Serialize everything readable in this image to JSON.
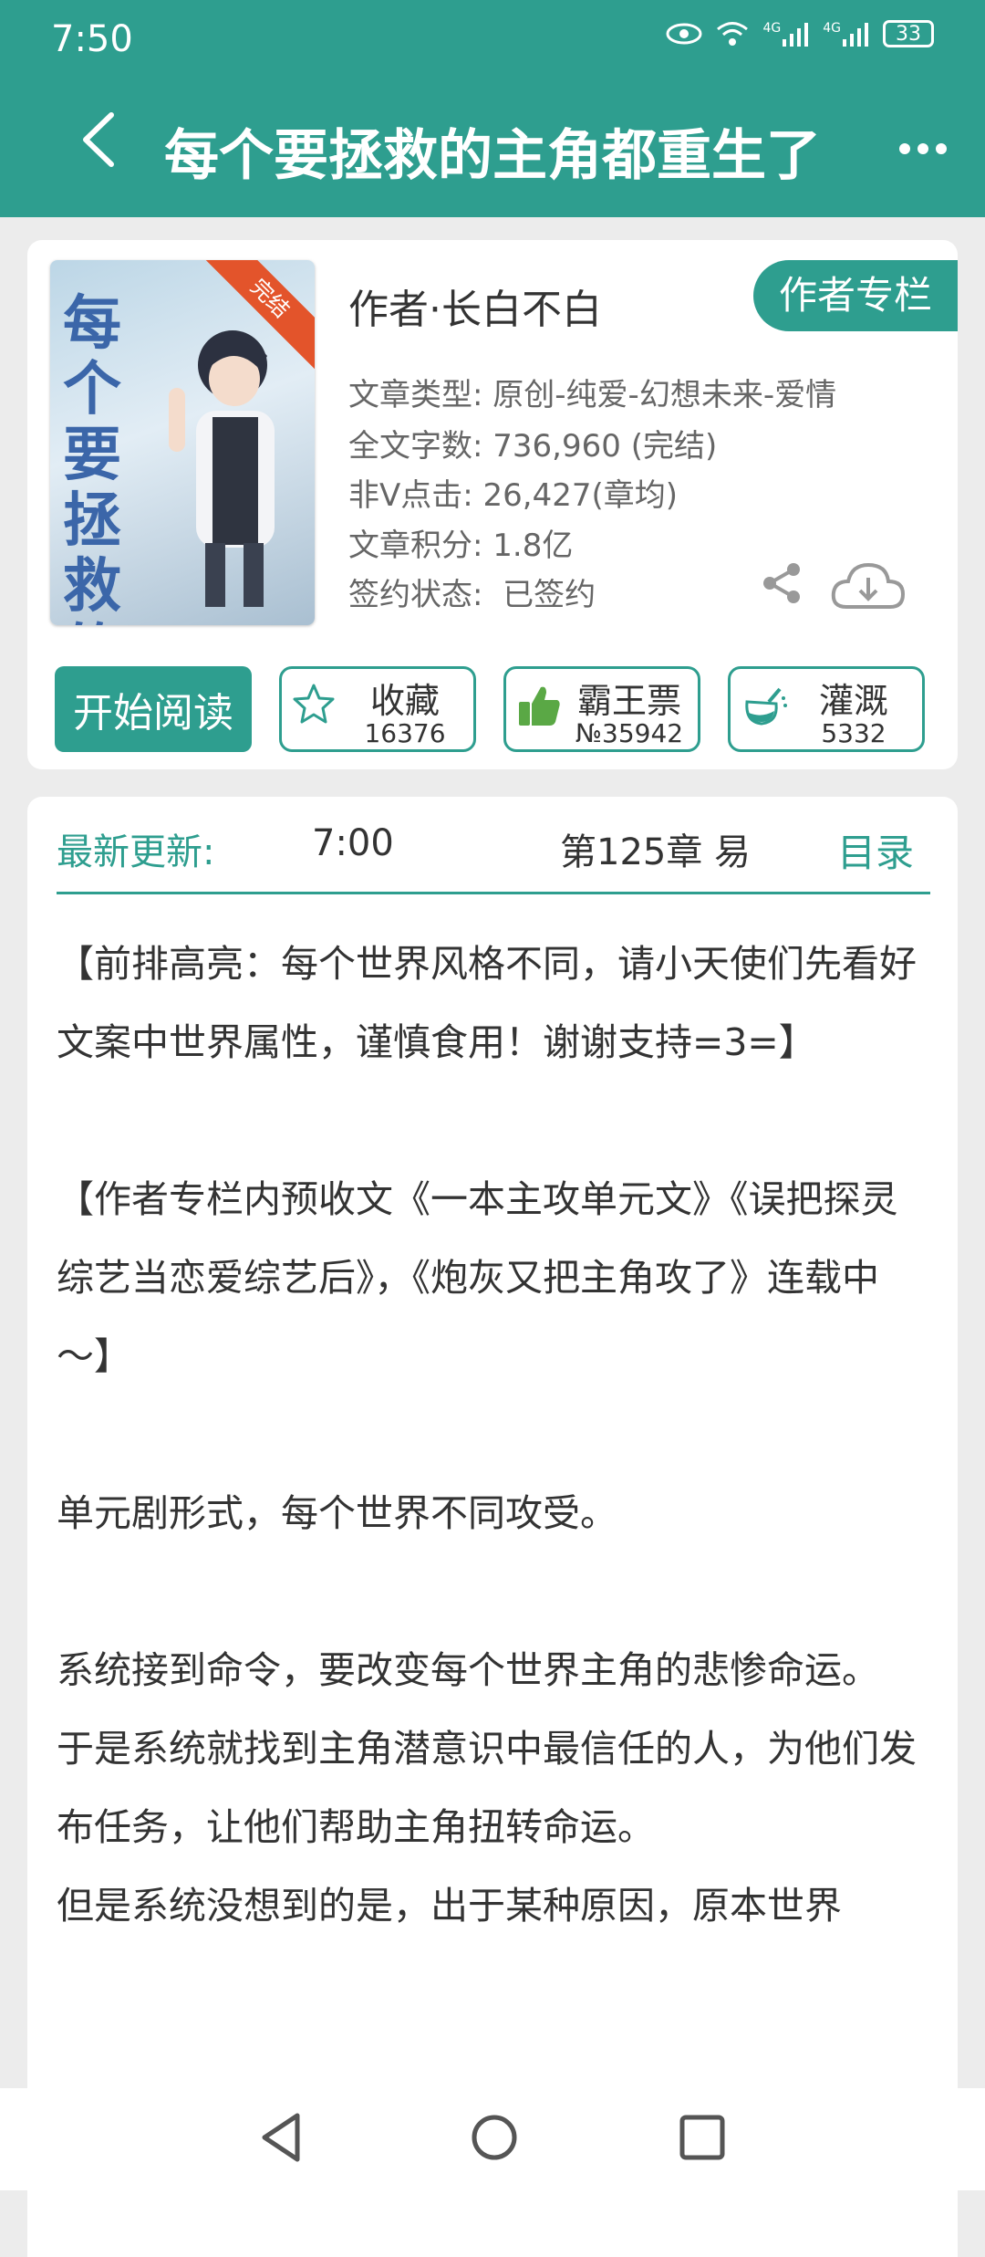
{
  "status_bar": {
    "time": "7:50",
    "network1": "4G",
    "network2": "4G",
    "battery": "33"
  },
  "header": {
    "title": "每个要拯救的主角都重生了",
    "back_icon": "chevron-left-icon",
    "more_icon": "more-horizontal-icon"
  },
  "book": {
    "cover_ribbon": "完结",
    "cover_title": "每个要 拯救的主角 都重生了",
    "author": "作者·长白不白",
    "author_column_button": "作者专栏",
    "meta": [
      {
        "label": "文章类型:",
        "value": "原创-纯爱-幻想未来-爱情"
      },
      {
        "label": "全文字数:",
        "value": "736,960 (完结)"
      },
      {
        "label": "非Ⅴ点击:",
        "value": "26,427(章均)"
      },
      {
        "label": "文章积分:",
        "value": "1.8亿"
      },
      {
        "label": "签约状态:",
        "value": "已签约"
      }
    ]
  },
  "actions": {
    "start_reading": "开始阅读",
    "favorite": {
      "label": "收藏",
      "count": "16376"
    },
    "tickets": {
      "label": "霸王票",
      "count": "№35942"
    },
    "nutrient": {
      "label": "灌溉",
      "count": "5332"
    }
  },
  "latest": {
    "label": "最新更新:",
    "time": "7:00",
    "chapter": "第125章  易",
    "toc": "目录"
  },
  "description": [
    "【前排高亮：每个世界风格不同，请小天使们先看好文案中世界属性，谨慎食用！谢谢支持=3=】",
    "",
    "【作者专栏内预收文《一本主攻单元文》《误把探灵综艺当恋爱综艺后》，《炮灰又把主角攻了》连载中～】",
    "",
    "单元剧形式，每个世界不同攻受。",
    "",
    "系统接到命令，要改变每个世界主角的悲惨命运。",
    "于是系统就找到主角潜意识中最信任的人，为他们发布任务，让他们帮助主角扭转命运。",
    "但是系统没想到的是，出于某种原因，原本世界"
  ],
  "colors": {
    "primary": "#2e9e8f",
    "ribbon": "#e3542b"
  }
}
